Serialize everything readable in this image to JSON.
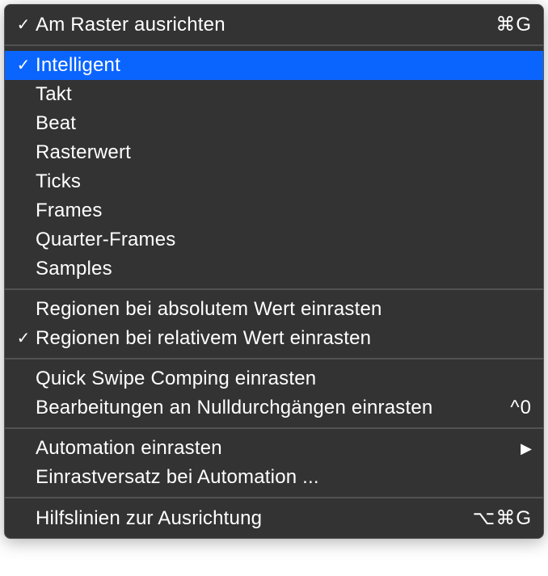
{
  "sections": [
    {
      "items": [
        {
          "id": "snap-to-grid",
          "label": "Am Raster ausrichten",
          "checked": true,
          "shortcut": "⌘G"
        }
      ]
    },
    {
      "items": [
        {
          "id": "intelligent",
          "label": "Intelligent",
          "checked": true,
          "highlighted": true
        },
        {
          "id": "takt",
          "label": "Takt"
        },
        {
          "id": "beat",
          "label": "Beat"
        },
        {
          "id": "rasterwert",
          "label": "Rasterwert"
        },
        {
          "id": "ticks",
          "label": "Ticks"
        },
        {
          "id": "frames",
          "label": "Frames"
        },
        {
          "id": "quarter-frames",
          "label": "Quarter-Frames"
        },
        {
          "id": "samples",
          "label": "Samples"
        }
      ]
    },
    {
      "items": [
        {
          "id": "snap-regions-absolute",
          "label": "Regionen bei absolutem Wert einrasten"
        },
        {
          "id": "snap-regions-relative",
          "label": "Regionen bei relativem Wert einrasten",
          "checked": true
        }
      ]
    },
    {
      "items": [
        {
          "id": "quick-swipe-comping",
          "label": "Quick Swipe Comping einrasten"
        },
        {
          "id": "edits-zero-crossings",
          "label": "Bearbeitungen an Nulldurchgängen einrasten",
          "shortcut": "^0"
        }
      ]
    },
    {
      "items": [
        {
          "id": "snap-automation",
          "label": "Automation einrasten",
          "submenu": true
        },
        {
          "id": "automation-snap-offset",
          "label": "Einrastversatz bei Automation ..."
        }
      ]
    },
    {
      "items": [
        {
          "id": "alignment-guides",
          "label": "Hilfslinien zur Ausrichtung",
          "shortcut": "⌥⌘G"
        }
      ]
    }
  ]
}
